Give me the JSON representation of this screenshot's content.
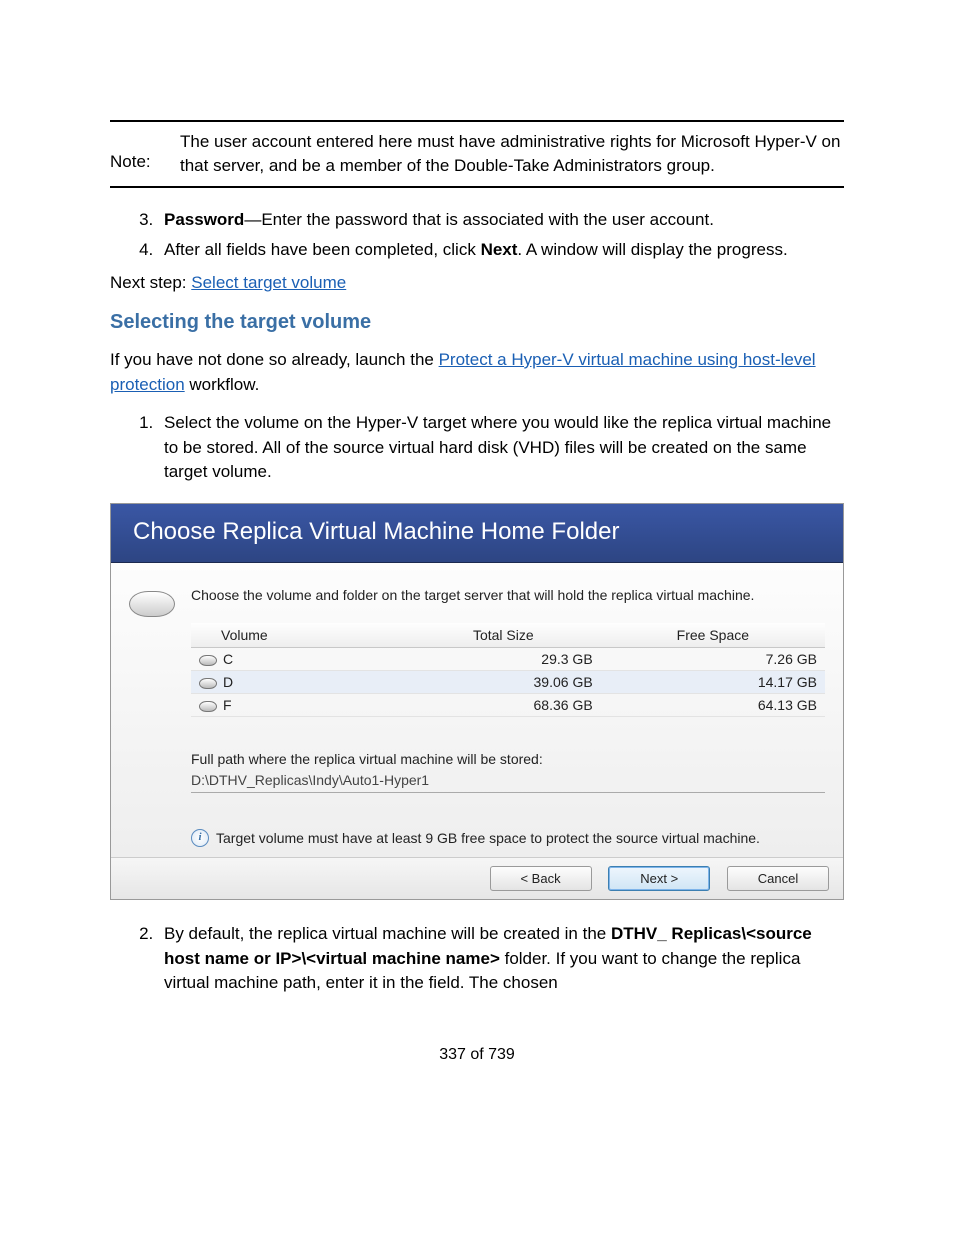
{
  "note": {
    "label": "Note:",
    "text": "The user account entered here must have administrative rights for Microsoft Hyper-V on that server, and be a member of the Double-Take Administrators group."
  },
  "step3": {
    "bold": "Password",
    "rest": "—Enter the password that is associated with the user account."
  },
  "step4": {
    "pre": "After all fields have been completed, click ",
    "bold": "Next",
    "post": ". A window will display the progress."
  },
  "next_step_label": "Next step: ",
  "next_step_link": "Select target volume",
  "section_heading": "Selecting the target volume",
  "intro_pre": "If you have not done so already, launch the  ",
  "intro_link": "Protect a Hyper-V virtual machine using host-level protection",
  "intro_post": " workflow.",
  "list2_1": "Select the volume on the Hyper-V target where you would like the replica virtual machine to be stored. All of the source virtual hard disk (VHD) files will be created on the same target volume.",
  "list2_2_pre": "By default, the replica virtual machine will be created in the ",
  "list2_2_bold": "DTHV_ Replicas\\<source host name or IP>\\<virtual machine name>",
  "list2_2_post": " folder. If you want to change the replica virtual machine path, enter it in the field. The chosen",
  "wizard": {
    "title": "Choose Replica Virtual Machine Home Folder",
    "instruction": "Choose the volume and folder on the target server that will hold the replica virtual machine.",
    "headers": {
      "volume": "Volume",
      "total": "Total Size",
      "free": "Free Space"
    },
    "rows": [
      {
        "vol": "C",
        "total": "29.3 GB",
        "free": "7.26 GB"
      },
      {
        "vol": "D",
        "total": "39.06 GB",
        "free": "14.17 GB"
      },
      {
        "vol": "F",
        "total": "68.36 GB",
        "free": "64.13 GB"
      }
    ],
    "path_label": "Full path where the replica virtual machine will be stored:",
    "path_value": "D:\\DTHV_Replicas\\Indy\\Auto1-Hyper1",
    "hint": "Target volume must have at least 9 GB free space to protect the source virtual machine.",
    "buttons": {
      "back": "< Back",
      "next": "Next >",
      "cancel": "Cancel"
    }
  },
  "page_footer": "337 of 739"
}
